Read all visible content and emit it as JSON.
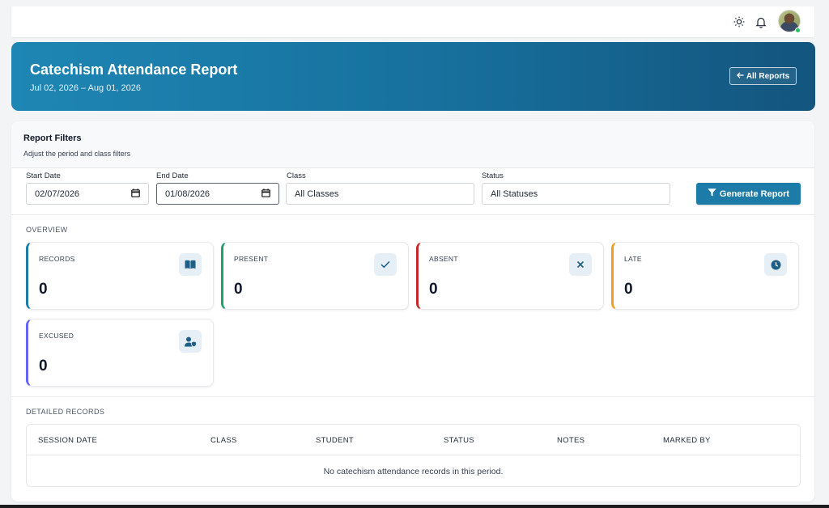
{
  "header": {
    "theme_icon": "sun-icon",
    "notification_icon": "bell-icon"
  },
  "banner": {
    "title": "Catechism Attendance Report",
    "date_range": "Jul 02, 2026 – Aug 01, 2026",
    "back_button": "All Reports"
  },
  "filters": {
    "heading": "Report Filters",
    "subheading": "Adjust the period and class filters",
    "start_date_label": "Start Date",
    "start_date_value": "02/07/2026",
    "end_date_label": "End Date",
    "end_date_value": "01/08/2026",
    "class_label": "Class",
    "class_value": "All Classes",
    "status_label": "Status",
    "status_value": "All Statuses",
    "generate_button": "Generate Report"
  },
  "overview": {
    "label": "OVERVIEW",
    "stats": [
      {
        "label": "RECORDS",
        "value": "0",
        "icon": "book-icon",
        "color": "#1d7ba8"
      },
      {
        "label": "PRESENT",
        "value": "0",
        "icon": "check-icon",
        "color": "#22a06b"
      },
      {
        "label": "ABSENT",
        "value": "0",
        "icon": "close-icon",
        "color": "#c62828"
      },
      {
        "label": "LATE",
        "value": "0",
        "icon": "clock-icon",
        "color": "#f0a020"
      },
      {
        "label": "EXCUSED",
        "value": "0",
        "icon": "user-shield-icon",
        "color": "#6366f1"
      }
    ]
  },
  "records": {
    "label": "DETAILED RECORDS",
    "columns": [
      "SESSION DATE",
      "CLASS",
      "STUDENT",
      "STATUS",
      "NOTES",
      "MARKED BY"
    ],
    "empty_message": "No catechism attendance records in this period."
  },
  "colors": {
    "accent": "#1d7ba8",
    "banner_start": "#1e86b4",
    "banner_end": "#13557e"
  }
}
